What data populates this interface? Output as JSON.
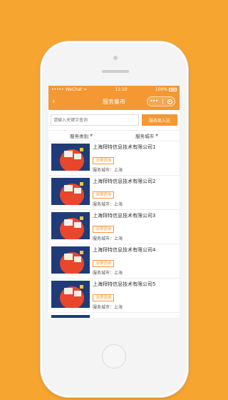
{
  "status": {
    "carrier": "WeChat",
    "signal": "•••••",
    "wifi": "≈",
    "time": "11:10",
    "battery": "100%"
  },
  "nav": {
    "back_icon": "‹",
    "title": "服务集市",
    "more_icon": "•••"
  },
  "search": {
    "placeholder": "请输入关键字查询",
    "apply_label": "服务商入驻"
  },
  "filters": [
    {
      "label": "服务类别",
      "chev": "▼"
    },
    {
      "label": "服务城市",
      "chev": "▼"
    }
  ],
  "items": [
    {
      "name": "上海拜特信息技术有限公司1",
      "tag": "法律咨询",
      "city": "服务城市：上海"
    },
    {
      "name": "上海拜特信息技术有限公司2",
      "tag": "法律咨询",
      "city": "服务城市：上海"
    },
    {
      "name": "上海拜特信息技术有限公司3",
      "tag": "法律咨询",
      "city": "服务城市：上海"
    },
    {
      "name": "上海拜特信息技术有限公司4",
      "tag": "法律咨询",
      "city": "服务城市：上海"
    },
    {
      "name": "上海拜特信息技术有限公司5",
      "tag": "法律咨询",
      "city": "服务城市：上海"
    }
  ],
  "colors": {
    "accent": "#f39833",
    "background": "#f7a531"
  }
}
